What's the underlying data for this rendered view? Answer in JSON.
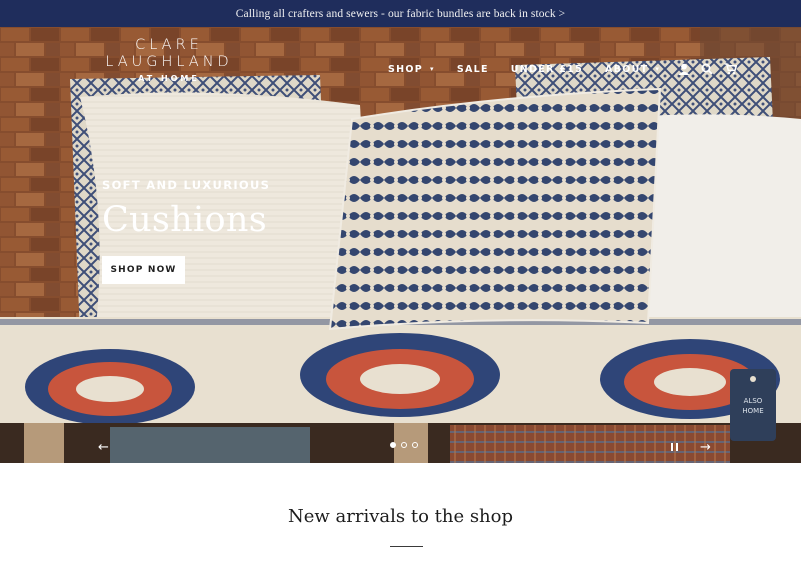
{
  "announcement": {
    "text": "Calling all crafters and sewers - our fabric bundles are back in stock >"
  },
  "logo": {
    "line1": "CLARE",
    "line2": "LAUGHLAND",
    "line3": "AT HOME"
  },
  "nav": {
    "items": [
      {
        "label": "SHOP",
        "caret": "▾"
      },
      {
        "label": "SALE"
      },
      {
        "label": "UNDER £15"
      },
      {
        "label": "ABOUT",
        "caret": "▾"
      }
    ],
    "icons": [
      "account-icon",
      "search-icon",
      "cart-icon"
    ]
  },
  "hero": {
    "subtitle": "SOFT AND LUXURIOUS",
    "title": "Cushions",
    "button": "SHOP NOW",
    "prev_arrow": "←",
    "next_arrow": "→",
    "slide_count": 3,
    "active_slide": 1,
    "tag_text": [
      "ALSO",
      "HOME"
    ]
  },
  "section": {
    "title": "New arrivals to the shop"
  },
  "colors": {
    "announce_bar": "#1f2d5c",
    "cushion_blue": "#3a4d7a",
    "accent_red": "#c8553d",
    "brick": "#9a5a36"
  }
}
